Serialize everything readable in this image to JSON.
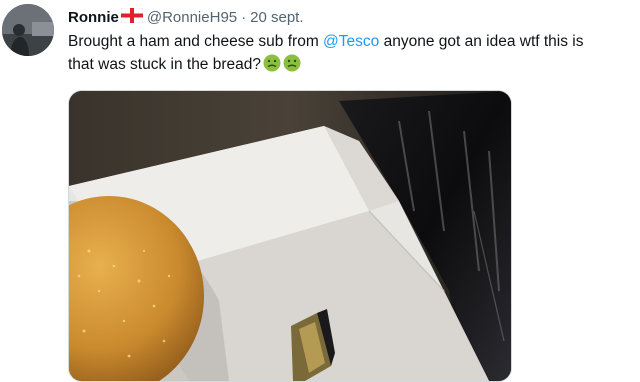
{
  "tweet": {
    "author_name": "Ronnie",
    "author_flag": "england-flag-emoji",
    "handle": "@RonnieH95",
    "separator": "·",
    "date": "20 sept.",
    "text_part1": "Brought a ham and cheese sub from ",
    "mention": "@Tesco",
    "text_part2": " anyone got an idea wtf this is",
    "text_line2": "that was stuck in the bread?",
    "emojis": [
      "nauseated-face-emoji",
      "nauseated-face-emoji"
    ]
  },
  "media": {
    "description_icon": "photo-of-sandwich-on-paper-tray"
  },
  "colors": {
    "mention": "#1d9bf0",
    "secondary_text": "#536471",
    "emoji_green": "#8cbf3f"
  }
}
